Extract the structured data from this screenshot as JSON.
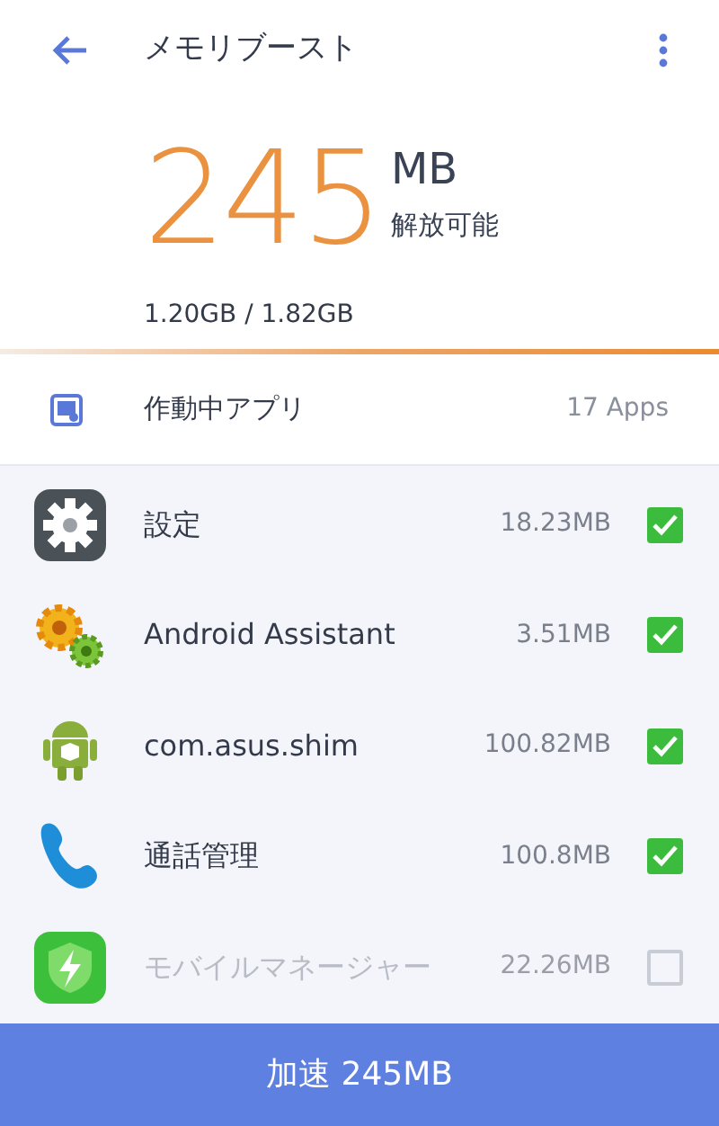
{
  "header": {
    "title": "メモリブースト"
  },
  "summary": {
    "amount": "245",
    "unit": "MB",
    "caption": "解放可能",
    "usage": "1.20GB / 1.82GB"
  },
  "section": {
    "label": "作動中アプリ",
    "count": "17 Apps"
  },
  "apps": [
    {
      "kind": "settings",
      "name": "設定",
      "size": "18.23MB",
      "checked": true
    },
    {
      "kind": "gears",
      "name": "Android Assistant",
      "size": "3.51MB",
      "checked": true
    },
    {
      "kind": "android",
      "name": "com.asus.shim",
      "size": "100.82MB",
      "checked": true
    },
    {
      "kind": "phone",
      "name": "通話管理",
      "size": "100.8MB",
      "checked": true
    },
    {
      "kind": "shield",
      "name": "モバイルマネージャー",
      "size": "22.26MB",
      "checked": false
    }
  ],
  "action": {
    "label": "加速 245MB"
  }
}
